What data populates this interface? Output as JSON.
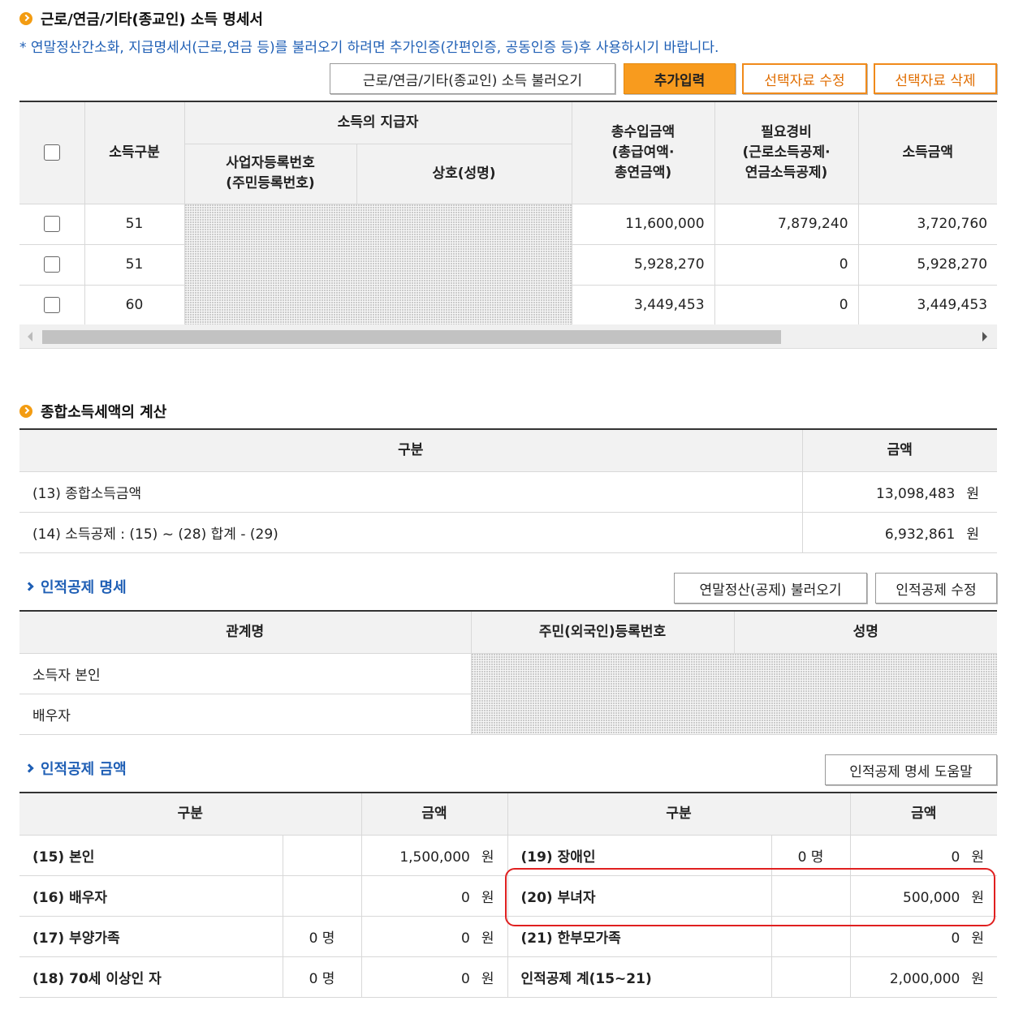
{
  "income_section": {
    "title": "근로/연금/기타(종교인) 소득 명세서",
    "notice": "* 연말정산간소화, 지급명세서(근로,연금 등)를 불러오기 하려면 추가인증(간편인증, 공동인증 등)후 사용하시기 바랍니다.",
    "buttons": {
      "load": "근로/연금/기타(종교인) 소득 불러오기",
      "add": "추가입력",
      "edit": "선택자료 수정",
      "delete": "선택자료 삭제"
    },
    "headers": {
      "type": "소득구분",
      "payer": "소득의 지급자",
      "bizno": "사업자등록번호\n(주민등록번호)",
      "name": "상호(성명)",
      "gross": "총수입금액\n(총급여액·\n총연금액)",
      "expense": "필요경비\n(근로소득공제·\n연금소득공제)",
      "income": "소득금액"
    },
    "rows": [
      {
        "type": "51",
        "gross": "11,600,000",
        "expense": "7,879,240",
        "income": "3,720,760"
      },
      {
        "type": "51",
        "gross": "5,928,270",
        "expense": "0",
        "income": "5,928,270"
      },
      {
        "type": "60",
        "gross": "3,449,453",
        "expense": "0",
        "income": "3,449,453"
      }
    ]
  },
  "tax_section": {
    "title": "종합소득세액의 계산",
    "headers": {
      "category": "구분",
      "amount": "금액"
    },
    "rows": [
      {
        "label": "(13) 종합소득금액",
        "amount": "13,098,483",
        "unit": "원"
      },
      {
        "label": "(14) 소득공제 : (15) ~ (28) 합계 - (29)",
        "amount": "6,932,861",
        "unit": "원"
      }
    ]
  },
  "personal_detail": {
    "title": "인적공제 명세",
    "buttons": {
      "load": "연말정산(공제) 불러오기",
      "edit": "인적공제 수정"
    },
    "headers": {
      "relation": "관계명",
      "regno": "주민(외국인)등록번호",
      "name": "성명"
    },
    "rows": [
      {
        "relation": "소득자 본인"
      },
      {
        "relation": "배우자"
      }
    ]
  },
  "personal_amount": {
    "title": "인적공제 금액",
    "help_button": "인적공제 명세 도움말",
    "headers": {
      "category": "구분",
      "amount": "금액"
    },
    "left_rows": [
      {
        "label": "(15) 본인",
        "count": "",
        "amount": "1,500,000",
        "unit": "원"
      },
      {
        "label": "(16) 배우자",
        "count": "",
        "amount": "0",
        "unit": "원"
      },
      {
        "label": "(17) 부양가족",
        "count": "0 명",
        "amount": "0",
        "unit": "원"
      },
      {
        "label": "(18) 70세 이상인 자",
        "count": "0 명",
        "amount": "0",
        "unit": "원"
      }
    ],
    "right_rows": [
      {
        "label": "(19) 장애인",
        "count": "0 명",
        "amount": "0",
        "unit": "원"
      },
      {
        "label": "(20) 부녀자",
        "count": "",
        "amount": "500,000",
        "unit": "원"
      },
      {
        "label": "(21) 한부모가족",
        "count": "",
        "amount": "0",
        "unit": "원"
      },
      {
        "label": "인적공제 계(15~21)",
        "count": "",
        "amount": "2,000,000",
        "unit": "원"
      }
    ]
  },
  "colors": {
    "accent_orange": "#f89b1e",
    "link_blue": "#1f5fb5",
    "highlight_red": "#e02020"
  }
}
